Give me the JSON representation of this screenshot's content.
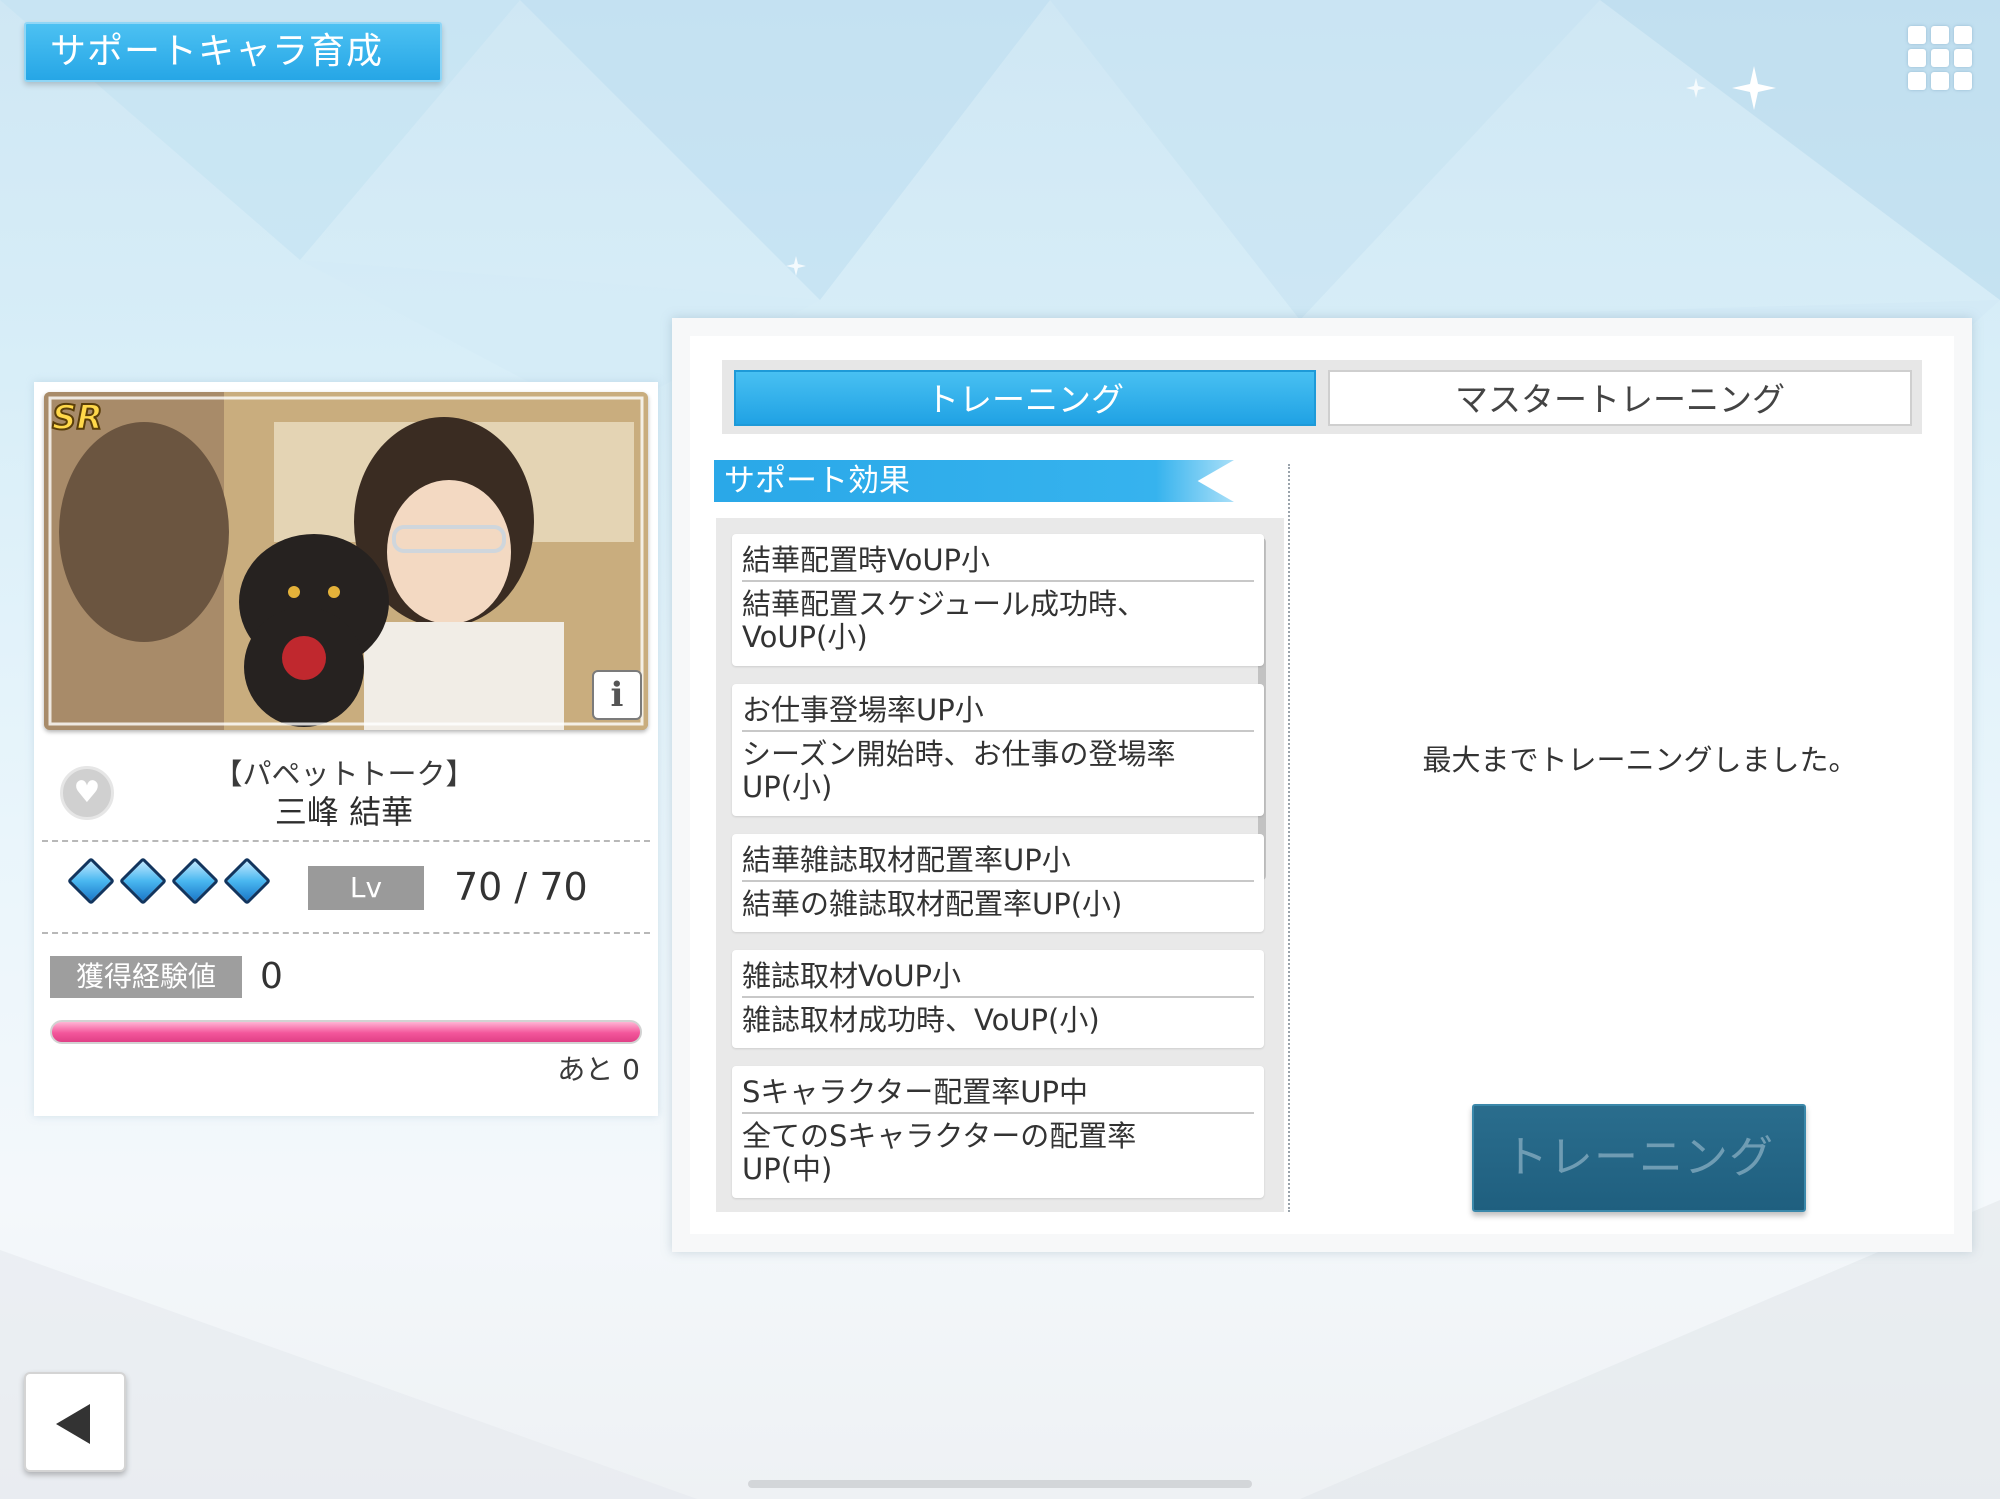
{
  "header": {
    "title": "サポートキャラ育成",
    "menu_icon": "grid-menu-icon"
  },
  "card": {
    "rarity": "SR",
    "info_label": "i",
    "subtitle": "【パペットトーク】",
    "name": "三峰 結華",
    "diamonds": 4,
    "level_label": "Lv",
    "level_value": "70 / 70",
    "exp_label": "獲得経験値",
    "exp_value": "0",
    "exp_progress": 1.0,
    "remaining": "あと 0"
  },
  "tabs": {
    "training": "トレーニング",
    "master_training": "マスタートレーニング",
    "active": "training"
  },
  "section": {
    "title": "サポート効果"
  },
  "effects": [
    {
      "name": "結華配置時VoUP小",
      "desc": "結華配置スケジュール成功時、\nVoUP(小)"
    },
    {
      "name": "お仕事登場率UP小",
      "desc": "シーズン開始時、お仕事の登場率\nUP(小)"
    },
    {
      "name": "結華雑誌取材配置率UP小",
      "desc": "結華の雑誌取材配置率UP(小)"
    },
    {
      "name": "雑誌取材VoUP小",
      "desc": "雑誌取材成功時、VoUP(小)"
    },
    {
      "name": "Sキャラクター配置率UP中",
      "desc": "全てのSキャラクターの配置率\nUP(中)"
    }
  ],
  "message": "最大までトレーニングしました。",
  "train_button": "トレーニング",
  "colors": {
    "accent": "#26a6e6",
    "exp_bar": "#f3569b",
    "button_disabled": "#1f5f7f"
  }
}
